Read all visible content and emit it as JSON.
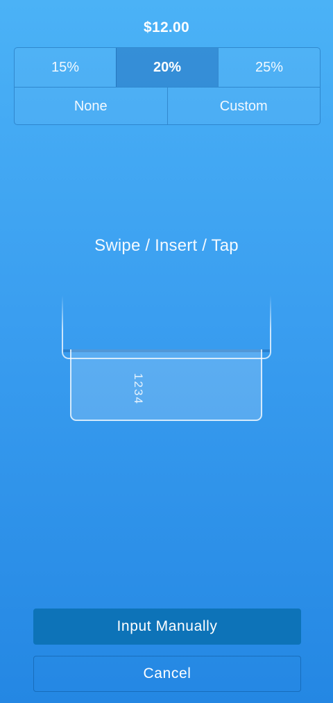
{
  "amount": "$12.00",
  "tips": {
    "row1": [
      "15%",
      "20%",
      "25%"
    ],
    "row2": [
      "None",
      "Custom"
    ],
    "selected": "20%"
  },
  "prompt": "Swipe / Insert / Tap",
  "card_number": "1234",
  "buttons": {
    "input_manually": "Input Manually",
    "cancel": "Cancel"
  },
  "colors": {
    "background_top": "#4bb2f6",
    "background_bottom": "#2487e3",
    "primary_button": "#0d73b8",
    "text": "#ffffff"
  }
}
